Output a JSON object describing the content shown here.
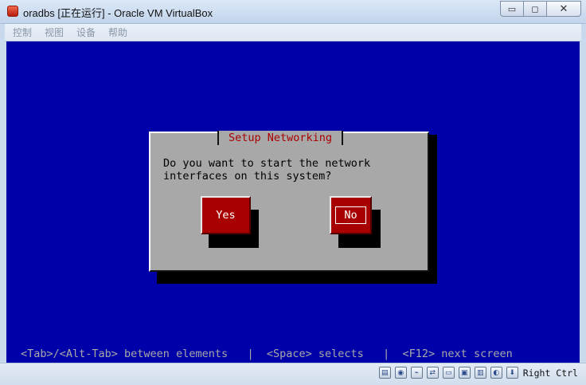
{
  "window": {
    "title": "oradbs [正在运行] - Oracle VM VirtualBox",
    "controls": {
      "minimize": "▭",
      "maximize": "◻",
      "close": "✕"
    }
  },
  "menu": [
    "控制",
    "视图",
    "设备",
    "帮助"
  ],
  "dialog": {
    "title": "Setup Networking",
    "message": "Do you want to start the network\ninterfaces on this system?",
    "buttons": {
      "yes": "Yes",
      "no": "No"
    },
    "focused": "no"
  },
  "hint": "<Tab>/<Alt-Tab> between elements   |  <Space> selects   |  <F12> next screen",
  "statusbar": {
    "icons": [
      "hdd-icon",
      "cd-icon",
      "usb-icon",
      "network-icon",
      "shared-folder-icon",
      "display-icon",
      "recording-icon",
      "mouse-icon",
      "keyboard-icon"
    ],
    "host_key": "Right Ctrl"
  },
  "colors": {
    "vm_background": "#0000a8",
    "dialog_bg": "#a8a8a8",
    "button_bg": "#a80000",
    "title_text": "#a80000"
  }
}
